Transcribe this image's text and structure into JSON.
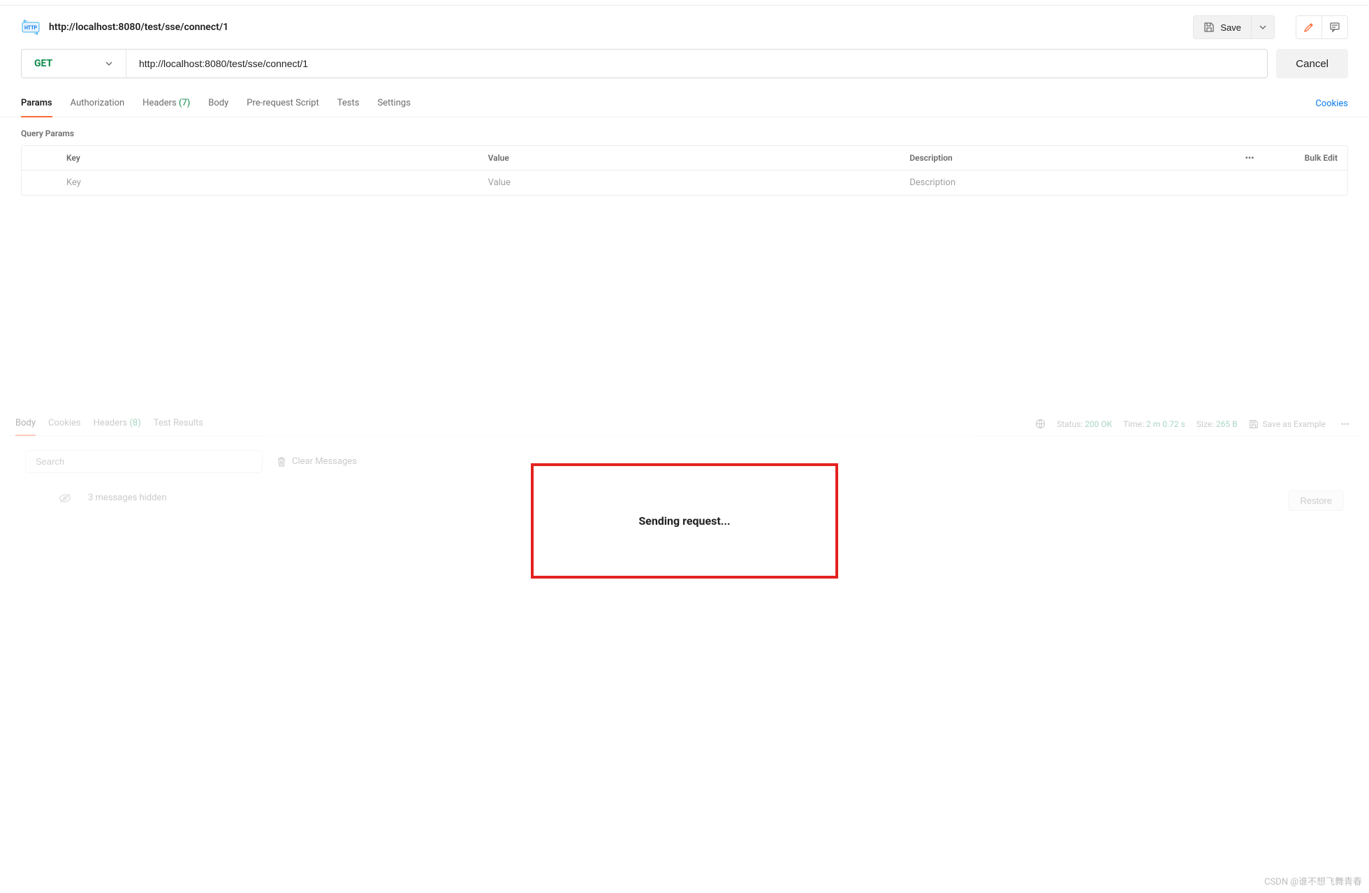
{
  "header": {
    "title": "http://localhost:8080/test/sse/connect/1",
    "save_label": "Save"
  },
  "request": {
    "method": "GET",
    "url": "http://localhost:8080/test/sse/connect/1",
    "cancel_label": "Cancel"
  },
  "tabs": {
    "params": "Params",
    "authorization": "Authorization",
    "headers": "Headers",
    "headers_count": "(7)",
    "body": "Body",
    "prerequest": "Pre-request Script",
    "tests": "Tests",
    "settings": "Settings",
    "cookies": "Cookies"
  },
  "params": {
    "section_title": "Query Params",
    "header_key": "Key",
    "header_value": "Value",
    "header_desc": "Description",
    "bulk_edit": "Bulk Edit",
    "placeholder_key": "Key",
    "placeholder_value": "Value",
    "placeholder_desc": "Description"
  },
  "response": {
    "tabs": {
      "body": "Body",
      "cookies": "Cookies",
      "headers": "Headers",
      "headers_count": "(8)",
      "test_results": "Test Results"
    },
    "status_label": "Status:",
    "status_value": "200 OK",
    "time_label": "Time:",
    "time_value": "2 m 0.72 s",
    "size_label": "Size:",
    "size_value": "265 B",
    "save_example": "Save as Example",
    "search_placeholder": "Search",
    "clear_messages": "Clear Messages",
    "hidden_messages": "3 messages hidden",
    "restore": "Restore"
  },
  "overlay": {
    "sending": "Sending request..."
  },
  "watermark": "CSDN @谁不想飞舞青春"
}
